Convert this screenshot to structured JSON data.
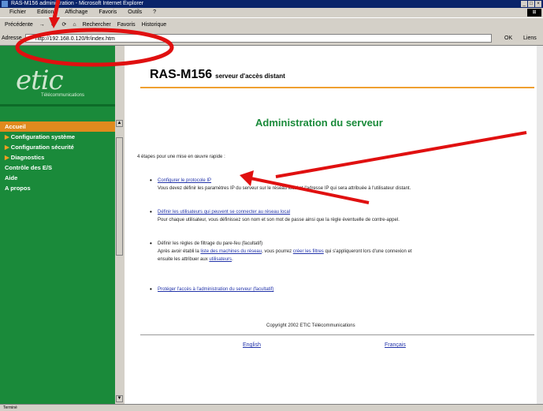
{
  "window": {
    "title": "RAS-M156 administration - Microsoft Internet Explorer",
    "controls": [
      "_",
      "□",
      "×"
    ]
  },
  "menubar": {
    "items": [
      "Fichier",
      "Edition",
      "Affichage",
      "Favoris",
      "Outils",
      "?"
    ]
  },
  "toolbar": {
    "items": [
      "Précédente",
      "→",
      "⊗",
      "⟳",
      "⌂",
      "Rechercher",
      "Favoris",
      "Historique"
    ]
  },
  "address": {
    "label": "Adresse",
    "value": "http://192.168.0.120/fr/index.htm",
    "go_label": "OK",
    "links_label": "Liens"
  },
  "sidebar": {
    "logo": "etic",
    "logo_sub": "Télécommunications",
    "items": [
      {
        "label": "Accueil",
        "arrow": ""
      },
      {
        "label": "Configuration système",
        "arrow": "▶"
      },
      {
        "label": "Configuration sécurité",
        "arrow": "▶"
      },
      {
        "label": "Diagnostics",
        "arrow": "▶"
      },
      {
        "label": "Contrôle des E/S",
        "arrow": ""
      },
      {
        "label": "Aide",
        "arrow": ""
      },
      {
        "label": "A propos",
        "arrow": ""
      }
    ]
  },
  "main": {
    "product": "RAS-M156",
    "product_sub": "serveur d'accès distant",
    "heading": "Administration du serveur",
    "intro": "4 étapes pour une mise en œuvre rapide :",
    "steps": [
      {
        "link": "Configurer le protocole IP",
        "desc": "Vous devez définir les paramètres IP du serveur sur le réseau local et l'adresse IP qui sera attribuée à l'utilisateur distant."
      },
      {
        "link": "Définir les utilisateurs qui peuvent se connecter au réseau local",
        "desc": "Pour chaque utilisateur, vous définissez son nom et son mot de passe ainsi que la règle éventuelle de contre-appel."
      },
      {
        "text": "Définir les règles de filtrage du pare-feu (facultatif)",
        "desc_prefix": "Après avoir établi la ",
        "desc_link1": "liste des machines du réseau",
        "desc_mid": ", vous pourrez ",
        "desc_link2": "créer les filtres",
        "desc_suffix": " qui s'appliqueront lors d'une connexion et",
        "desc2_prefix": "ensuite les attribuer aux ",
        "desc2_link": "utilisateurs",
        "desc2_suffix": "."
      },
      {
        "link": "Protéger l'accès à l'administration du serveur (facultatif)"
      }
    ],
    "copyright": "Copyright 2002 ETIC Télécommunications",
    "lang_en": "English",
    "lang_fr": "Français"
  },
  "status": {
    "text": "Terminé"
  },
  "colors": {
    "sidebar_bg": "#1a8a3a",
    "active_item": "#e08a1e",
    "heading": "#1a8a3a",
    "annotation": "#e01010"
  }
}
